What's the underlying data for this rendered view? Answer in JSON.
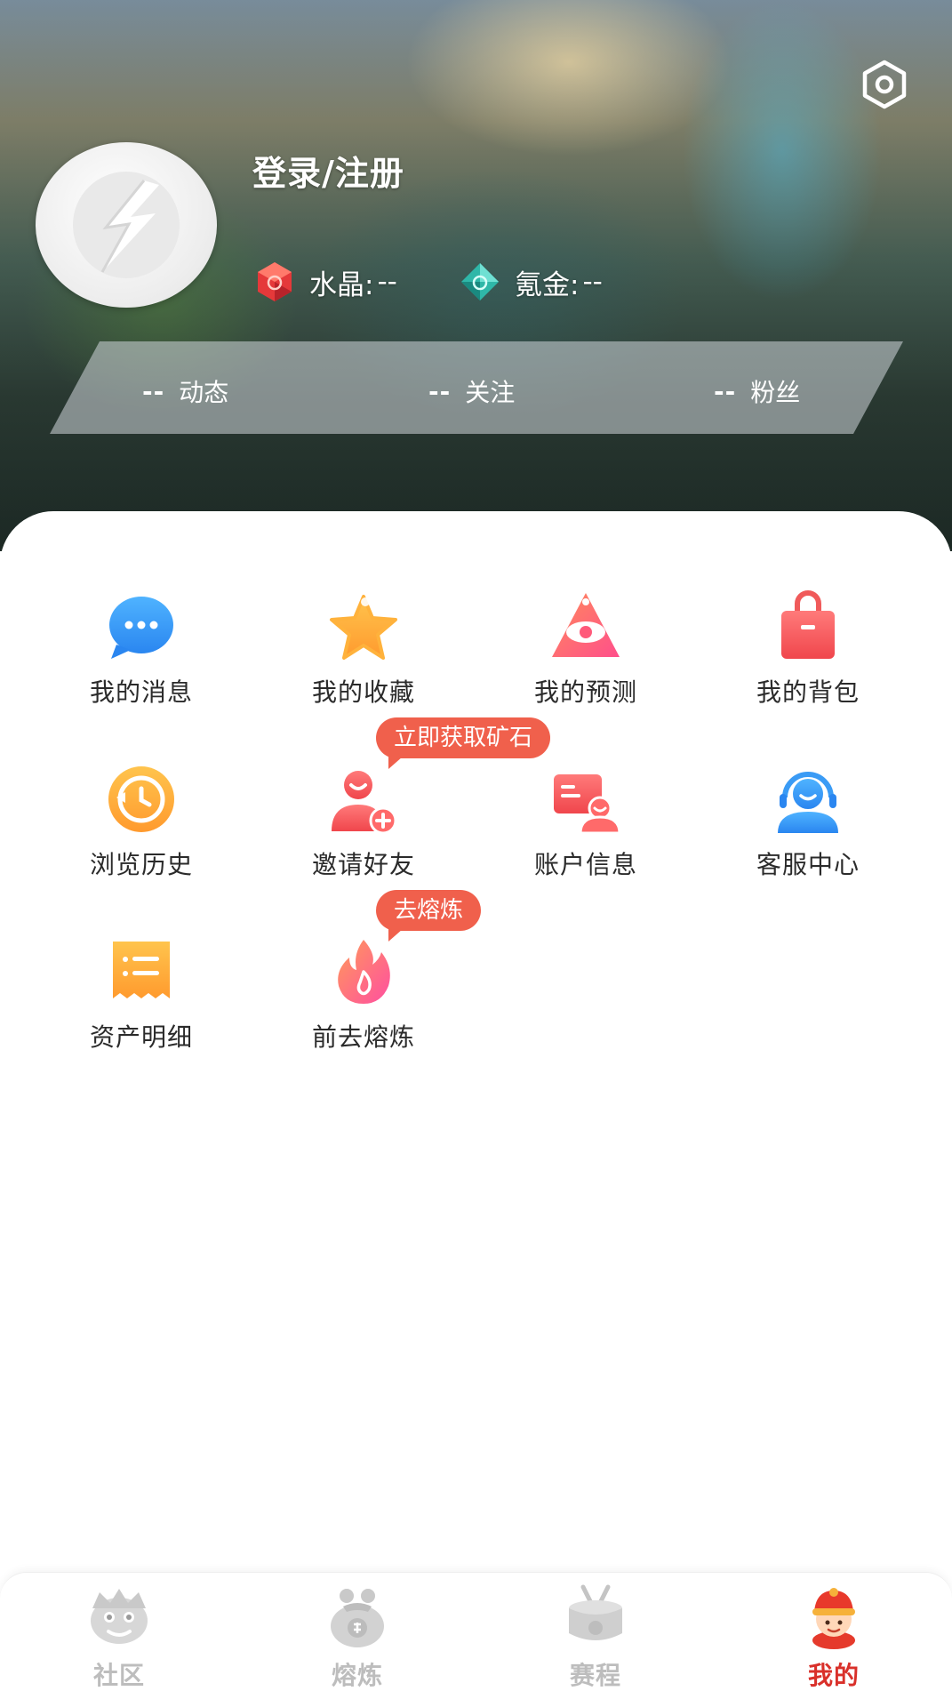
{
  "header": {
    "login_label": "登录/注册",
    "currencies": [
      {
        "label": "水晶:",
        "value": "--",
        "icon": "red-crystal-icon"
      },
      {
        "label": "氪金:",
        "value": "--",
        "icon": "teal-gem-icon"
      }
    ],
    "stats": [
      {
        "num": "--",
        "label": "动态"
      },
      {
        "num": "--",
        "label": "关注"
      },
      {
        "num": "--",
        "label": "粉丝"
      }
    ]
  },
  "menu": {
    "items": [
      {
        "label": "我的消息",
        "icon": "chat-bubble-icon"
      },
      {
        "label": "我的收藏",
        "icon": "star-icon"
      },
      {
        "label": "我的预测",
        "icon": "eye-triangle-icon"
      },
      {
        "label": "我的背包",
        "icon": "shopping-bag-icon"
      },
      {
        "label": "浏览历史",
        "icon": "history-clock-icon"
      },
      {
        "label": "邀请好友",
        "icon": "add-friend-icon"
      },
      {
        "label": "账户信息",
        "icon": "account-card-icon"
      },
      {
        "label": "客服中心",
        "icon": "headset-icon"
      },
      {
        "label": "资产明细",
        "icon": "receipt-icon"
      },
      {
        "label": "前去熔炼",
        "icon": "flame-icon"
      }
    ],
    "bubbles": {
      "invite": "立即获取矿石",
      "smelt": "去熔炼"
    }
  },
  "tabbar": {
    "tabs": [
      {
        "label": "社区",
        "icon": "lion-icon",
        "active": false
      },
      {
        "label": "熔炼",
        "icon": "lucky-bag-icon",
        "active": false
      },
      {
        "label": "赛程",
        "icon": "drum-icon",
        "active": false
      },
      {
        "label": "我的",
        "icon": "mascot-icon",
        "active": true
      }
    ]
  },
  "colors": {
    "accent_red": "#d9302a",
    "bubble": "#f0604c",
    "tab_inactive": "#bdbdbd"
  }
}
